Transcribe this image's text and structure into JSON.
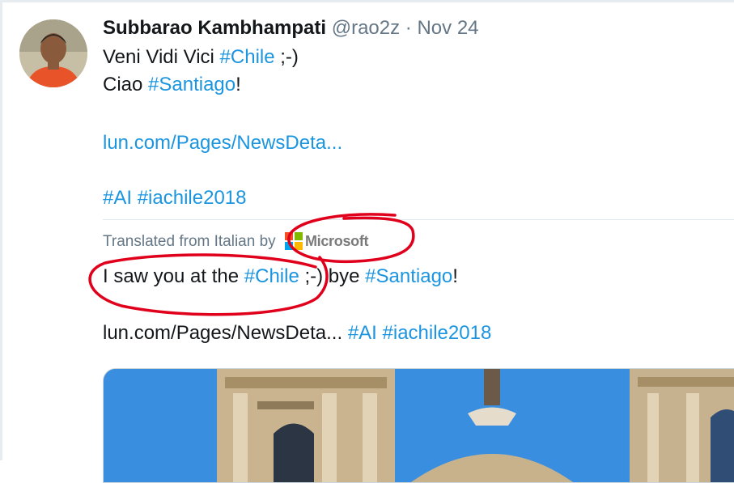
{
  "tweet": {
    "author_name": "Subbarao Kambhampati",
    "handle": "@rao2z",
    "separator": "·",
    "date": "Nov 24",
    "line1_text": "Veni Vidi Vici ",
    "line1_hashtag": "#Chile",
    "line1_suffix": " ;-)",
    "line2_text": "Ciao ",
    "line2_hashtag": "#Santiago",
    "line2_suffix": "!",
    "link": "lun.com/Pages/NewsDeta...",
    "hashtag_ai": "#AI",
    "hashtag_iachile": "#iachile2018"
  },
  "translation": {
    "label": "Translated from Italian by",
    "provider": "Microsoft",
    "text_prefix": "I saw you at the ",
    "hashtag_chile": "#Chile",
    "text_middle": " ;-) bye ",
    "hashtag_santiago": "#Santiago",
    "text_suffix": "!",
    "link": "lun.com/Pages/NewsDeta...",
    "hashtag_ai": "#AI",
    "hashtag_iachile": "#iachile2018"
  },
  "colors": {
    "link": "#1b95e0",
    "muted": "#657786",
    "annotation": "#e0001b"
  },
  "icons": {
    "microsoft_logo": "microsoft-logo-icon"
  }
}
